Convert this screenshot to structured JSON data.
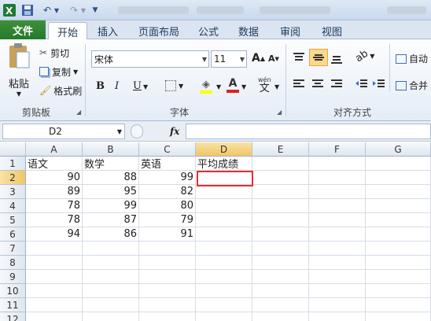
{
  "quick_access": {
    "save_icon": "save-icon",
    "undo_icon": "undo-icon",
    "redo_icon": "redo-icon"
  },
  "tabs": [
    {
      "label": "文件"
    },
    {
      "label": "开始"
    },
    {
      "label": "插入"
    },
    {
      "label": "页面布局"
    },
    {
      "label": "公式"
    },
    {
      "label": "数据"
    },
    {
      "label": "审阅"
    },
    {
      "label": "视图"
    }
  ],
  "ribbon": {
    "clipboard": {
      "paste": "粘贴",
      "cut": "剪切",
      "copy": "复制",
      "format_painter": "格式刷",
      "group_label": "剪贴板"
    },
    "font": {
      "font_name": "宋体",
      "font_size": "11",
      "bold": "B",
      "italic": "I",
      "underline": "U",
      "phonetic": "wén",
      "phonetic_char": "文",
      "group_label": "字体"
    },
    "alignment": {
      "wrap": "自动",
      "merge": "合并",
      "group_label": "对齐方式"
    }
  },
  "formula_bar": {
    "name_box": "D2",
    "fx": "fx",
    "formula": ""
  },
  "sheet": {
    "columns": [
      "A",
      "B",
      "C",
      "D",
      "E",
      "F",
      "G"
    ],
    "rows": [
      "1",
      "2",
      "3",
      "4",
      "5",
      "6",
      "7",
      "8",
      "9",
      "10",
      "11",
      "12"
    ],
    "header_row": [
      "语文",
      "数学",
      "英语",
      "平均成绩"
    ],
    "data_rows": [
      [
        "90",
        "88",
        "99"
      ],
      [
        "89",
        "95",
        "82"
      ],
      [
        "78",
        "99",
        "80"
      ],
      [
        "78",
        "87",
        "79"
      ],
      [
        "94",
        "86",
        "91"
      ]
    ],
    "selected_cell": "D2"
  },
  "colors": {
    "file_tab": "#2d8a33",
    "selection_border": "#e03030",
    "header_highlight": "#f0c766"
  }
}
